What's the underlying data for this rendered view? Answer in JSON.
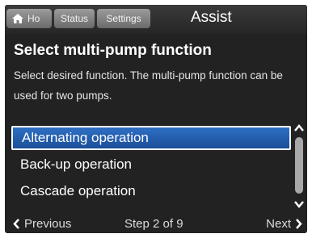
{
  "header": {
    "tabs": [
      {
        "label": "Ho",
        "icon": "home-icon"
      },
      {
        "label": "Status"
      },
      {
        "label": "Settings"
      }
    ],
    "title": "Assist"
  },
  "main": {
    "heading": "Select multi-pump function",
    "description": "Select desired function. The multi-pump function can be used for two pumps.",
    "options": [
      {
        "label": "Alternating operation",
        "selected": true
      },
      {
        "label": "Back-up operation",
        "selected": false
      },
      {
        "label": "Cascade operation",
        "selected": false
      }
    ]
  },
  "footer": {
    "previous_label": "Previous",
    "step_label": "Step 2 of 9",
    "next_label": "Next"
  },
  "colors": {
    "background": "#222222",
    "selection": "#2a62b4",
    "tab": "#8a8a8a"
  }
}
